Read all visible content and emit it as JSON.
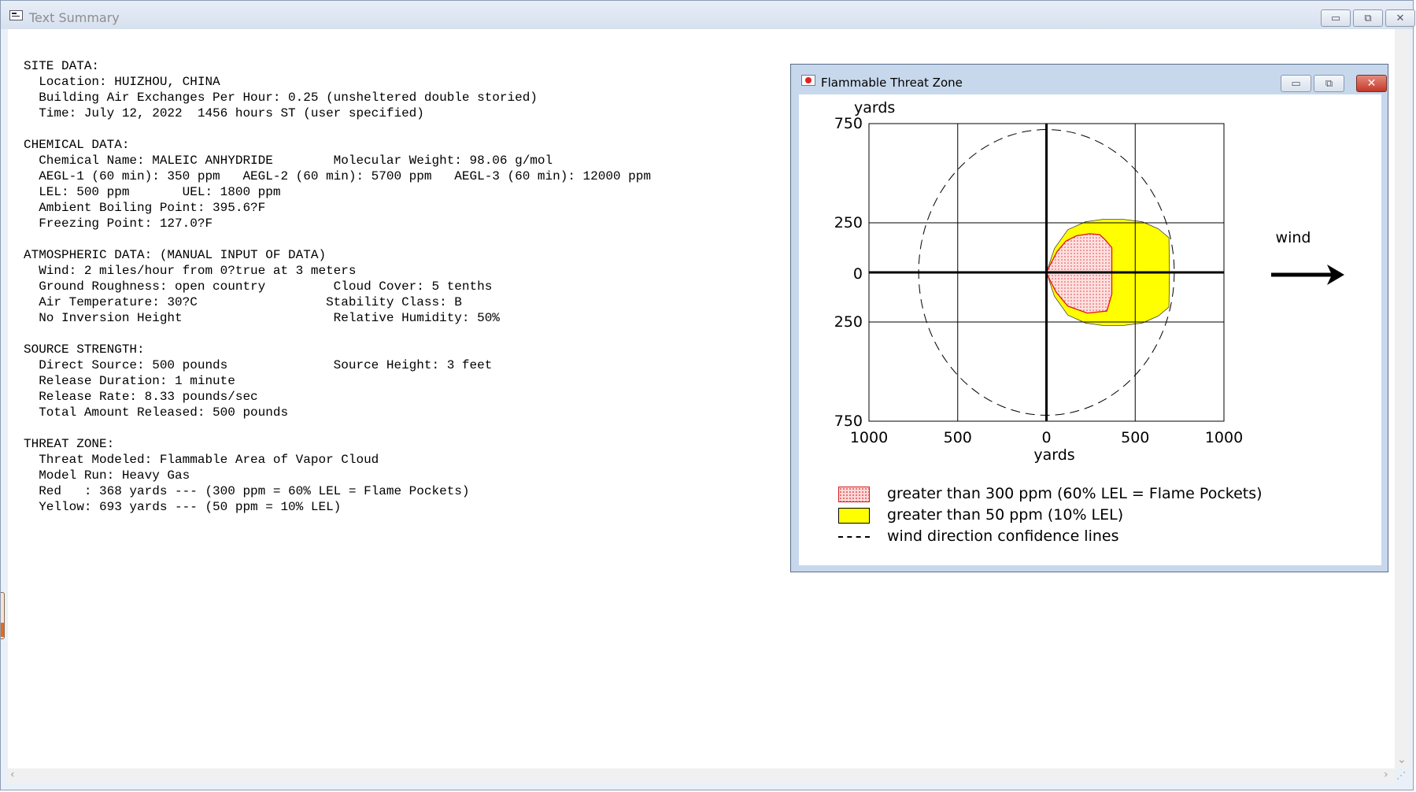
{
  "main_window": {
    "title": "Text Summary",
    "controls": {
      "minimize": "▭",
      "restore": "⧉",
      "close": "✕"
    }
  },
  "summary": {
    "lines": [
      "SITE DATA:",
      "  Location: HUIZHOU, CHINA",
      "  Building Air Exchanges Per Hour: 0.25 (unsheltered double storied)",
      "  Time: July 12, 2022  1456 hours ST (user specified)",
      "",
      "CHEMICAL DATA:",
      "  Chemical Name: MALEIC ANHYDRIDE        Molecular Weight: 98.06 g/mol",
      "  AEGL-1 (60 min): 350 ppm   AEGL-2 (60 min): 5700 ppm   AEGL-3 (60 min): 12000 ppm",
      "  LEL: 500 ppm       UEL: 1800 ppm",
      "  Ambient Boiling Point: 395.6?F",
      "  Freezing Point: 127.0?F",
      "",
      "ATMOSPHERIC DATA: (MANUAL INPUT OF DATA)",
      "  Wind: 2 miles/hour from 0?true at 3 meters",
      "  Ground Roughness: open country         Cloud Cover: 5 tenths",
      "  Air Temperature: 30?C                 Stability Class: B",
      "  No Inversion Height                    Relative Humidity: 50%",
      "",
      "SOURCE STRENGTH:",
      "  Direct Source: 500 pounds              Source Height: 3 feet",
      "  Release Duration: 1 minute",
      "  Release Rate: 8.33 pounds/sec",
      "  Total Amount Released: 500 pounds",
      "",
      "THREAT ZONE:",
      "  Threat Modeled: Flammable Area of Vapor Cloud",
      "  Model Run: Heavy Gas",
      "  Red   : 368 yards --- (300 ppm = 60% LEL = Flame Pockets)",
      "  Yellow: 693 yards --- (50 ppm = 10% LEL)"
    ]
  },
  "threat_window": {
    "title": "Flammable Threat Zone",
    "controls": {
      "minimize": "▭",
      "restore": "⧉",
      "close": "✕"
    }
  },
  "chart_data": {
    "type": "area",
    "title": "",
    "xlabel": "yards",
    "ylabel": "yards",
    "xlim": [
      -1000,
      1000
    ],
    "ylim": [
      -750,
      750
    ],
    "x_ticks": [
      "1000",
      "500",
      "0",
      "500",
      "1000"
    ],
    "y_ticks": [
      "750",
      "250",
      "0",
      "250",
      "750"
    ],
    "grid": true,
    "wind_label": "wind",
    "zones": [
      {
        "name": "greater than 50 ppm (10% LEL)",
        "color": "#ffff00",
        "outline": [
          [
            0,
            0
          ],
          [
            45,
            120
          ],
          [
            120,
            215
          ],
          [
            220,
            255
          ],
          [
            320,
            268
          ],
          [
            430,
            268
          ],
          [
            540,
            255
          ],
          [
            630,
            220
          ],
          [
            690,
            175
          ],
          [
            693,
            0
          ],
          [
            690,
            -175
          ],
          [
            630,
            -220
          ],
          [
            540,
            -255
          ],
          [
            430,
            -268
          ],
          [
            320,
            -268
          ],
          [
            220,
            -255
          ],
          [
            120,
            -215
          ],
          [
            45,
            -120
          ]
        ]
      },
      {
        "name": "greater than 300 ppm (60% LEL = Flame Pockets)",
        "color": "#ff9999",
        "outline": [
          [
            0,
            0
          ],
          [
            25,
            45
          ],
          [
            60,
            105
          ],
          [
            110,
            158
          ],
          [
            170,
            185
          ],
          [
            245,
            195
          ],
          [
            300,
            190
          ],
          [
            330,
            165
          ],
          [
            368,
            125
          ],
          [
            368,
            -110
          ],
          [
            340,
            -195
          ],
          [
            230,
            -205
          ],
          [
            120,
            -170
          ],
          [
            55,
            -100
          ],
          [
            20,
            -40
          ]
        ]
      }
    ],
    "confidence_circle_radius": 720,
    "legend": [
      {
        "label": "greater than 300 ppm (60% LEL = Flame Pockets)",
        "swatch": "pink-dotted"
      },
      {
        "label": "greater than 50 ppm (10% LEL)",
        "swatch": "yellow"
      },
      {
        "label": "wind direction confidence lines",
        "swatch": "dashed-line"
      }
    ]
  }
}
